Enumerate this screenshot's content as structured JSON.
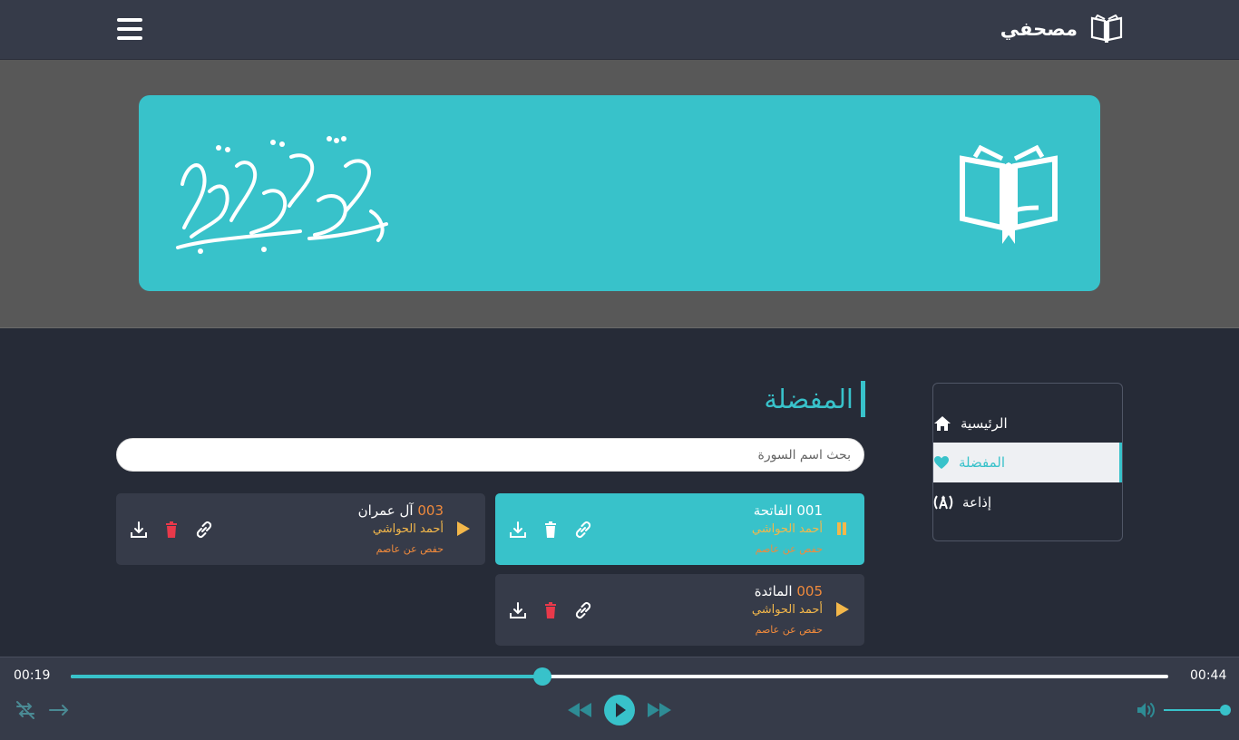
{
  "app": {
    "name": "مصحفي"
  },
  "sidebar": {
    "items": [
      {
        "label": "الرئيسية",
        "icon": "home-icon",
        "active": false
      },
      {
        "label": "المفضلة",
        "icon": "heart-icon",
        "active": true
      },
      {
        "label": "إذاعة",
        "icon": "radio-icon",
        "active": false
      }
    ]
  },
  "page": {
    "title": "المفضلة"
  },
  "search": {
    "placeholder": "بحث اسم السورة"
  },
  "favorites": [
    {
      "number": "001",
      "name": "الفاتحة",
      "reciter": "أحمد الحواشي",
      "riwaya": "حفص عن عاصم",
      "state": "playing"
    },
    {
      "number": "003",
      "name": "آل عمران",
      "reciter": "أحمد الحواشي",
      "riwaya": "حفص عن عاصم",
      "state": "paused"
    },
    {
      "number": "005",
      "name": "المائدة",
      "reciter": "أحمد الحواشي",
      "riwaya": "حفص عن عاصم",
      "state": "paused"
    }
  ],
  "player": {
    "current_time": "00:19",
    "duration": "00:44",
    "progress": 0.43,
    "volume": 1.0
  },
  "colors": {
    "accent": "#38c2ca",
    "orange": "#f08a3c",
    "gold": "#f3b74a",
    "danger": "#e8394a",
    "dark_bg": "#262b37",
    "card_bg": "#363b49"
  }
}
